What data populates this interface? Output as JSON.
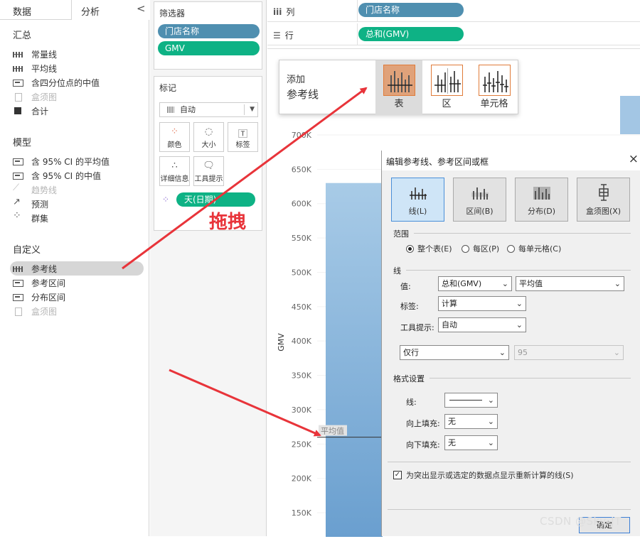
{
  "left_panel": {
    "tabs": {
      "data": "数据",
      "analysis": "分析"
    },
    "collapse_glyph": "<",
    "summary": {
      "title": "汇总",
      "items": [
        "常量线",
        "平均线",
        "含四分位点的中值",
        "盒须图",
        "合计"
      ]
    },
    "model": {
      "title": "模型",
      "items": [
        "含 95% CI 的平均值",
        "含 95% CI 的中值",
        "趋势线",
        "预测",
        "群集"
      ]
    },
    "custom": {
      "title": "自定义",
      "items": [
        "参考线",
        "参考区间",
        "分布区间",
        "盒须图"
      ]
    }
  },
  "filters": {
    "title": "筛选器",
    "pills": [
      "门店名称",
      "GMV"
    ]
  },
  "marks": {
    "title": "标记",
    "type": "自动",
    "buttons": [
      "颜色",
      "大小",
      "标签",
      "详细信息",
      "工具提示"
    ],
    "pill": "天(日期)"
  },
  "drag_annotation": "拖拽",
  "shelves": {
    "columns": {
      "glyph": "iii",
      "label": "列",
      "pill": "门店名称"
    },
    "rows": {
      "glyph": "☰",
      "label": "行",
      "pill": "总和(GMV)"
    }
  },
  "add_popup": {
    "line1": "添加",
    "line2": "参考线",
    "options": [
      "表",
      "区",
      "单元格"
    ]
  },
  "chart_data": {
    "type": "bar",
    "ylabel": "GMV",
    "y_ticks": [
      "700K",
      "650K",
      "600K",
      "550K",
      "500K",
      "450K",
      "400K",
      "350K",
      "300K",
      "250K",
      "200K",
      "150K"
    ],
    "ylim": [
      150000,
      700000
    ],
    "visible_bar_top": 630000,
    "reference_line": {
      "label": "平均值",
      "value": 260000
    },
    "bar_color": "#7eaed6"
  },
  "dialog": {
    "title": "编辑参考线、参考区间或框",
    "close": "×",
    "types": [
      "线(L)",
      "区间(B)",
      "分布(D)",
      "盒须图(X)"
    ],
    "scope": {
      "title": "范围",
      "options": [
        "整个表(E)",
        "每区(P)",
        "每单元格(C)"
      ],
      "selected": 0
    },
    "line": {
      "title": "线",
      "value_label": "值:",
      "value_field": "总和(GMV)",
      "value_agg": "平均值",
      "label_label": "标签:",
      "label_value": "计算",
      "tooltip_label": "工具提示:",
      "tooltip_value": "自动",
      "ci_mode": "仅行",
      "ci_value": "95"
    },
    "format": {
      "title": "格式设置",
      "line_label": "线:",
      "fill_above_label": "向上填充:",
      "fill_above_value": "无",
      "fill_below_label": "向下填充:",
      "fill_below_value": "无"
    },
    "recalc_checkbox": "为突出显示或选定的数据点显示重新计算的线(S)",
    "recalc_checked": true,
    "ok_button": "确定"
  },
  "watermark": "CSDN @Sky-JT"
}
